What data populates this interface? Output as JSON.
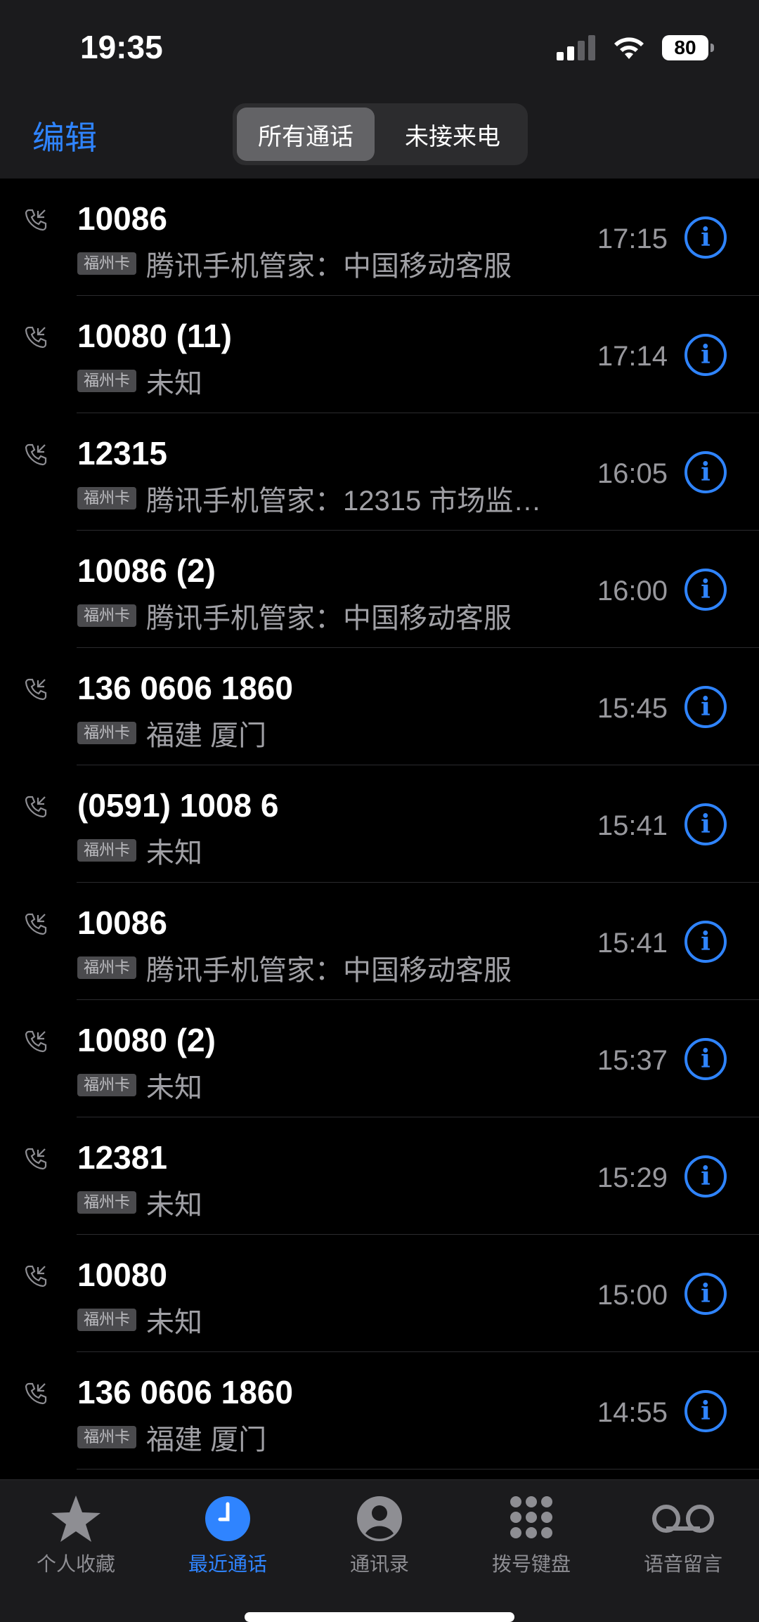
{
  "status": {
    "time": "19:35",
    "battery": "80"
  },
  "header": {
    "edit_label": "编辑",
    "segments": [
      "所有通话",
      "未接来电"
    ]
  },
  "calls": [
    {
      "name": "10086",
      "sim": "福州卡",
      "detail": "腾讯手机管家：中国移动客服",
      "time": "17:15",
      "icon": true
    },
    {
      "name": "10080 (11)",
      "sim": "福州卡",
      "detail": "未知",
      "time": "17:14",
      "icon": true
    },
    {
      "name": "12315",
      "sim": "福州卡",
      "detail": "腾讯手机管家：12315 市场监…",
      "time": "16:05",
      "icon": true
    },
    {
      "name": "10086 (2)",
      "sim": "福州卡",
      "detail": "腾讯手机管家：中国移动客服",
      "time": "16:00",
      "icon": false
    },
    {
      "name": "136 0606 1860",
      "sim": "福州卡",
      "detail": "福建 厦门",
      "time": "15:45",
      "icon": true
    },
    {
      "name": "(0591) 1008 6",
      "sim": "福州卡",
      "detail": "未知",
      "time": "15:41",
      "icon": true
    },
    {
      "name": "10086",
      "sim": "福州卡",
      "detail": "腾讯手机管家：中国移动客服",
      "time": "15:41",
      "icon": true
    },
    {
      "name": "10080 (2)",
      "sim": "福州卡",
      "detail": "未知",
      "time": "15:37",
      "icon": true
    },
    {
      "name": "12381",
      "sim": "福州卡",
      "detail": "未知",
      "time": "15:29",
      "icon": true
    },
    {
      "name": "10080",
      "sim": "福州卡",
      "detail": "未知",
      "time": "15:00",
      "icon": true
    },
    {
      "name": "136 0606 1860",
      "sim": "福州卡",
      "detail": "福建 厦门",
      "time": "14:55",
      "icon": true
    }
  ],
  "tabs": [
    {
      "label": "个人收藏",
      "icon": "star-icon"
    },
    {
      "label": "最近通话",
      "icon": "clock-icon",
      "active": true
    },
    {
      "label": "通讯录",
      "icon": "person-icon"
    },
    {
      "label": "拨号键盘",
      "icon": "keypad-icon"
    },
    {
      "label": "语音留言",
      "icon": "voicemail-icon"
    }
  ],
  "colors": {
    "accent": "#2f84ff",
    "background": "#000000",
    "bar": "#1b1b1d"
  }
}
